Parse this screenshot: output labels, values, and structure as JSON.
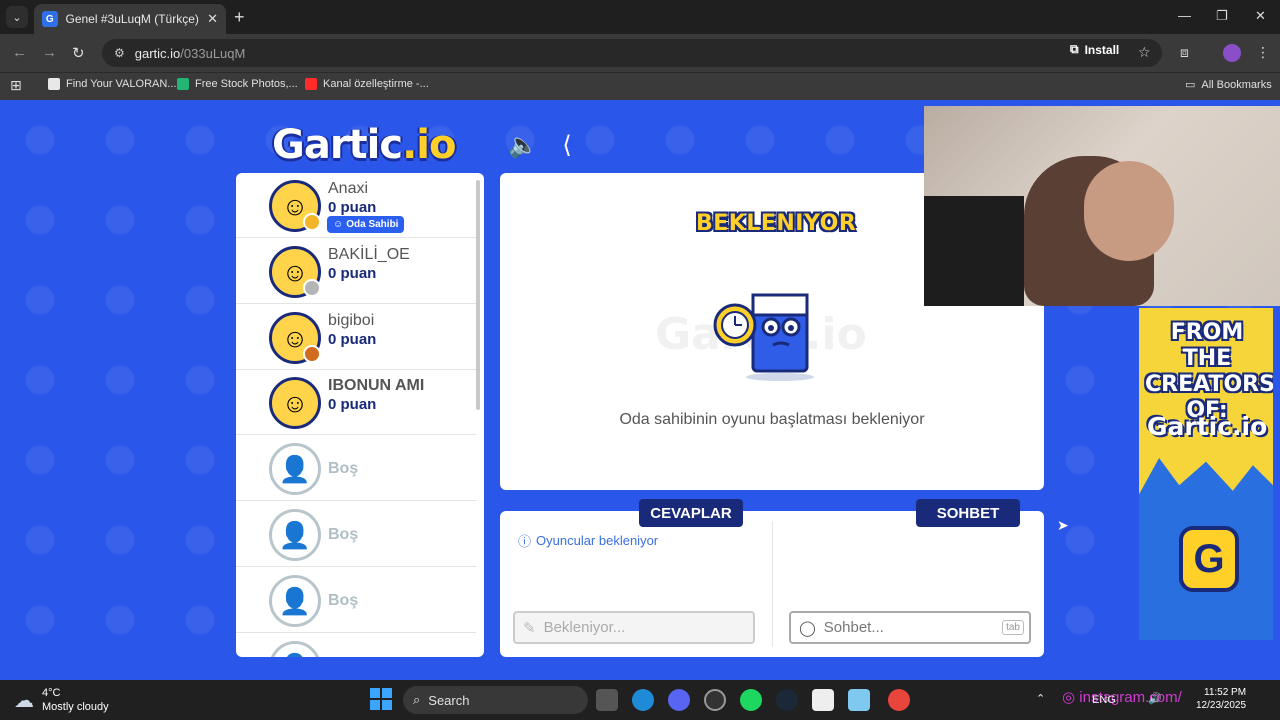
{
  "browser": {
    "tab_title": "Genel #3uLuqM (Türkçe) - Gartic.io",
    "tab_favicon": "G",
    "url_host": "gartic.io",
    "url_path": "/033uLuqM",
    "install_label": "Install",
    "bookmarks": [
      {
        "label": "Find Your VALORAN...",
        "color": "#e8e8e8"
      },
      {
        "label": "Free Stock Photos,...",
        "color": "#22b573"
      },
      {
        "label": "Kanal özelleştirme -...",
        "color": "#ff2b2b"
      }
    ],
    "all_bookmarks": "All Bookmarks"
  },
  "game": {
    "logo_main": "Gartic",
    "logo_suffix": ".io",
    "players": [
      {
        "name": "Anaxi",
        "score": "0 puan",
        "badge": "Oda Sahibi",
        "level_color": "#f2b52a"
      },
      {
        "name": "BAKİLİ_OE",
        "score": "0 puan",
        "level_color": "#b5b5b5"
      },
      {
        "name": "bigiboi",
        "score": "0 puan",
        "level_color": "#d16b1f"
      },
      {
        "name": "IBONUN AMI",
        "score": "0 puan",
        "level_color": ""
      }
    ],
    "empty_slot_label": "Boş",
    "status_title": "BEKLENIYOR",
    "watermark": "Gartic.io",
    "status_message": "Oda sahibinin oyunu başlatması bekleniyor",
    "answers_tab": "CEVAPLAR",
    "chat_tab": "SOHBET",
    "answers_info": "Oyuncular bekleniyor",
    "answer_placeholder": "Bekleniyor...",
    "chat_placeholder": "Sohbet...",
    "chat_tab_key": "tab"
  },
  "ad": {
    "headline": "FROM THE CREATORS OF:",
    "logo": "Gartic.io",
    "icon_letter": "G"
  },
  "taskbar": {
    "temperature": "4°C",
    "weather": "Mostly cloudy",
    "search_label": "Search",
    "lang": "ENG",
    "time": "11:52 PM",
    "date": "12/23/2025",
    "overlay_text": "instagram.com/"
  },
  "colors": {
    "game_bg": "#2a56e9",
    "navy": "#1a2a7a",
    "yellow": "#ffd027"
  }
}
